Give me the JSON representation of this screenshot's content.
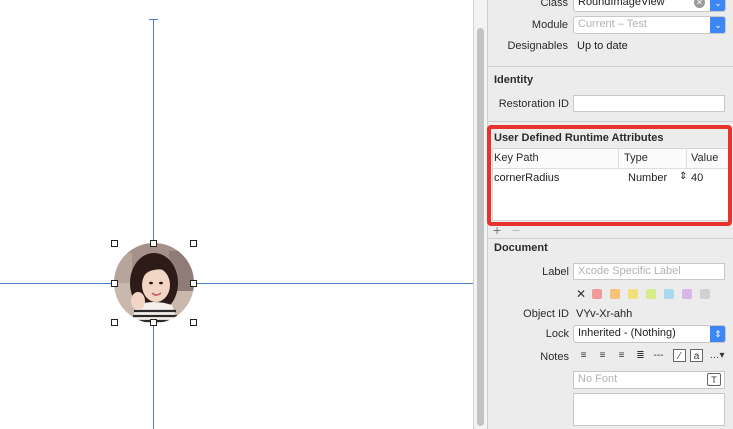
{
  "custom_class": {
    "class_label": "Class",
    "class_value": "RoundImageView",
    "module_label": "Module",
    "module_placeholder": "Current – Test",
    "designables_label": "Designables",
    "designables_value": "Up to date"
  },
  "identity": {
    "title": "Identity",
    "restoration_id_label": "Restoration ID",
    "restoration_id_value": ""
  },
  "runtime_attributes": {
    "title": "User Defined Runtime Attributes",
    "columns": [
      "Key Path",
      "Type",
      "Value"
    ],
    "rows": [
      {
        "key_path": "cornerRadius",
        "type": "Number",
        "value": "40"
      }
    ],
    "add_symbol": "+",
    "remove_symbol": "−",
    "highlight_color": "#e8322c"
  },
  "document": {
    "title": "Document",
    "label_label": "Label",
    "label_placeholder": "Xcode Specific Label",
    "label_colors": [
      "#f29a9a",
      "#f7c27a",
      "#f2e07c",
      "#d6ec8a",
      "#a9d8ef",
      "#d9b6ea",
      "#d1d1d1"
    ],
    "object_id_label": "Object ID",
    "object_id_value": "VYv-Xr-ahh",
    "lock_label": "Lock",
    "lock_value": "Inherited - (Nothing)",
    "notes_label": "Notes",
    "font_placeholder": "No Font"
  },
  "colors": {
    "guide_line": "#4a7fc4",
    "accent": "#3d86f7"
  }
}
